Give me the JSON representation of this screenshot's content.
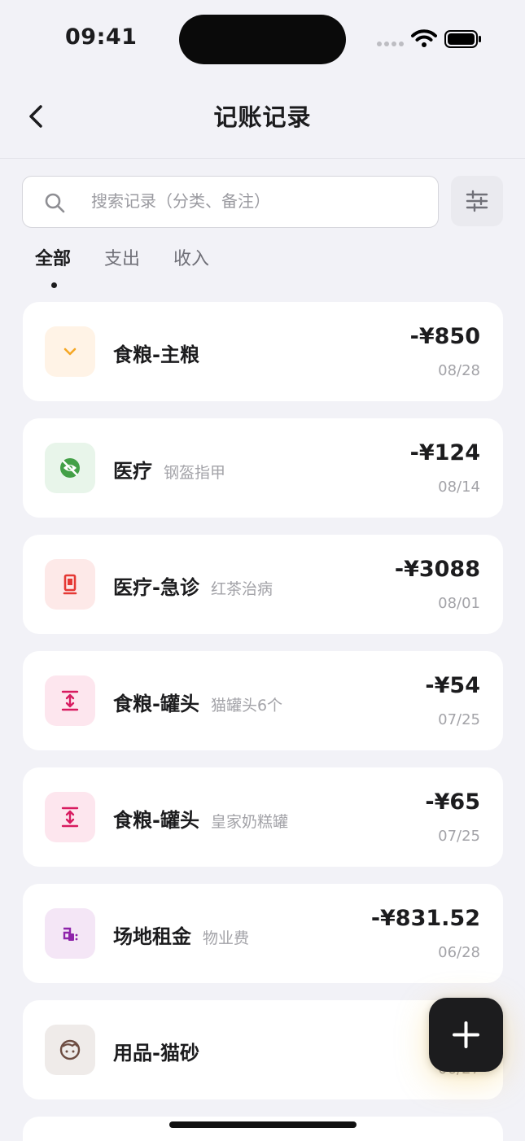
{
  "status": {
    "time": "09:41"
  },
  "nav": {
    "title": "记账记录"
  },
  "search": {
    "placeholder": "搜索记录（分类、备注）"
  },
  "tabs": [
    {
      "label": "全部",
      "active": true
    },
    {
      "label": "支出",
      "active": false
    },
    {
      "label": "收入",
      "active": false
    }
  ],
  "records": [
    {
      "category": "食粮-主粮",
      "note": "",
      "amount": "-¥850",
      "date": "08/28",
      "icon": "chevron-down-icon",
      "icon_color": "#f5a623",
      "icon_bg": "#fff3e6"
    },
    {
      "category": "医疗",
      "note": "钢盔指甲",
      "amount": "-¥124",
      "date": "08/14",
      "icon": "no-eye-icon",
      "icon_color": "#43a047",
      "icon_bg": "#e8f5ea"
    },
    {
      "category": "医疗-急诊",
      "note": "红茶治病",
      "amount": "-¥3088",
      "date": "08/01",
      "icon": "phone-icon",
      "icon_color": "#e53935",
      "icon_bg": "#fde9e8"
    },
    {
      "category": "食粮-罐头",
      "note": "猫罐头6个",
      "amount": "-¥54",
      "date": "07/25",
      "icon": "vertical-align-icon",
      "icon_color": "#d81b60",
      "icon_bg": "#fde6ee"
    },
    {
      "category": "食粮-罐头",
      "note": "皇家奶糕罐",
      "amount": "-¥65",
      "date": "07/25",
      "icon": "vertical-align-icon",
      "icon_color": "#d81b60",
      "icon_bg": "#fde6ee"
    },
    {
      "category": "场地租金",
      "note": "物业费",
      "amount": "-¥831.52",
      "date": "06/28",
      "icon": "plug-icon",
      "icon_color": "#8e24aa",
      "icon_bg": "#f4e6f6"
    },
    {
      "category": "用品-猫砂",
      "note": "",
      "amount": "-¥",
      "date": "06/27",
      "icon": "cat-face-icon",
      "icon_color": "#6d4c41",
      "icon_bg": "#efebe9"
    }
  ]
}
